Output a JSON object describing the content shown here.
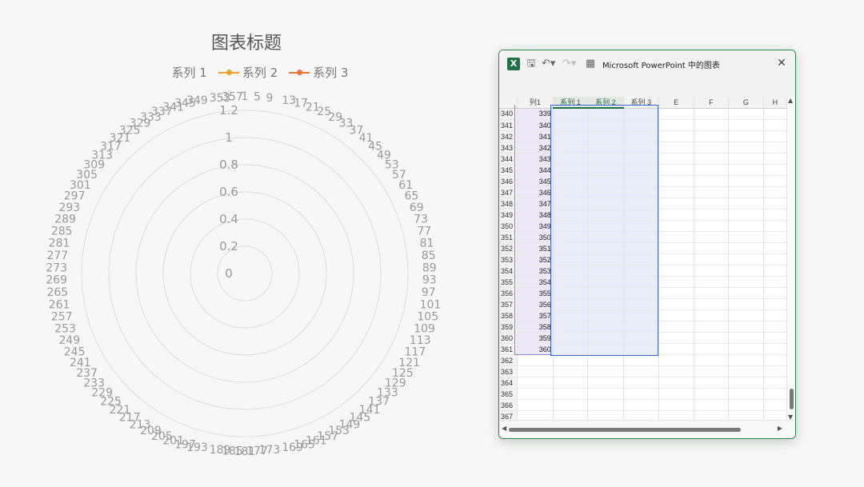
{
  "chart_data": {
    "type": "radar",
    "title": "图表标题",
    "legend": [
      "系列 1",
      "系列 2",
      "系列 3"
    ],
    "legend_position": "top",
    "series_colors": [
      "#777777",
      "#f0a030",
      "#e8743b"
    ],
    "categories_start": 1,
    "categories_end": 360,
    "categories_step_labelled": 4,
    "radial_ticks": [
      "0",
      "0.2",
      "0.4",
      "0.6",
      "0.8",
      "1",
      "1.2"
    ],
    "rlim": [
      0,
      1.2
    ],
    "series": [
      {
        "name": "系列 1",
        "values": []
      },
      {
        "name": "系列 2",
        "values": []
      },
      {
        "name": "系列 3",
        "values": []
      }
    ],
    "grid": true
  },
  "excel": {
    "title": "Microsoft PowerPoint 中的图表",
    "icons": {
      "app": "X",
      "save": "🖫",
      "undo": "↶▾",
      "redo": "↷▾",
      "table": "▦",
      "close": "✕"
    },
    "columns": [
      "列1",
      "系列 1",
      "系列 2",
      "系列 3",
      "E",
      "F",
      "G",
      "H"
    ],
    "rows": [
      {
        "r": "340",
        "v": "339"
      },
      {
        "r": "341",
        "v": "340"
      },
      {
        "r": "342",
        "v": "341"
      },
      {
        "r": "343",
        "v": "342"
      },
      {
        "r": "344",
        "v": "343"
      },
      {
        "r": "345",
        "v": "344"
      },
      {
        "r": "346",
        "v": "345"
      },
      {
        "r": "347",
        "v": "346"
      },
      {
        "r": "348",
        "v": "347"
      },
      {
        "r": "349",
        "v": "348"
      },
      {
        "r": "350",
        "v": "349"
      },
      {
        "r": "351",
        "v": "350"
      },
      {
        "r": "352",
        "v": "351"
      },
      {
        "r": "353",
        "v": "352"
      },
      {
        "r": "354",
        "v": "353"
      },
      {
        "r": "355",
        "v": "354"
      },
      {
        "r": "356",
        "v": "355"
      },
      {
        "r": "357",
        "v": "356"
      },
      {
        "r": "358",
        "v": "357"
      },
      {
        "r": "359",
        "v": "358"
      },
      {
        "r": "360",
        "v": "359"
      },
      {
        "r": "361",
        "v": "360"
      },
      {
        "r": "362",
        "v": ""
      },
      {
        "r": "363",
        "v": ""
      },
      {
        "r": "364",
        "v": ""
      },
      {
        "r": "365",
        "v": ""
      },
      {
        "r": "366",
        "v": ""
      },
      {
        "r": "367",
        "v": ""
      }
    ]
  }
}
